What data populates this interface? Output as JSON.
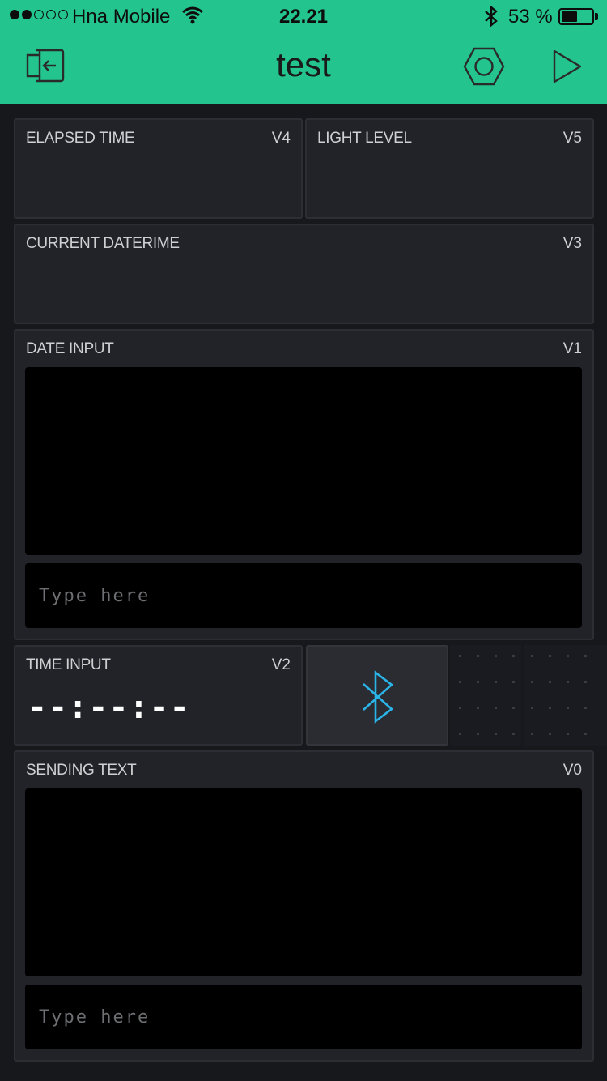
{
  "status_bar": {
    "carrier": "Hna Mobile",
    "time": "22.21",
    "battery_text": "53 %",
    "battery_level": 0.53,
    "signal_bars_filled": 2,
    "signal_bars_total": 5
  },
  "header": {
    "title": "test",
    "background": "#23c48e",
    "icons": [
      "exit-icon",
      "settings-hexagon-icon",
      "play-icon"
    ]
  },
  "widgets": {
    "elapsed_time": {
      "label": "ELAPSED TIME",
      "pin": "V4"
    },
    "light_level": {
      "label": "LIGHT LEVEL",
      "pin": "V5"
    },
    "current_datetime": {
      "label": "CURRENT DATERIME",
      "pin": "V3"
    },
    "date_input": {
      "label": "DATE INPUT",
      "pin": "V1",
      "placeholder": "Type here"
    },
    "time_input": {
      "label": "TIME INPUT",
      "pin": "V2",
      "value": "--:--:--"
    },
    "bluetooth": {
      "icon": "bluetooth-icon",
      "color": "#2bb4e8"
    },
    "sending_text": {
      "label": "SENDING TEXT",
      "pin": "V0",
      "placeholder": "Type here"
    }
  },
  "colors": {
    "app_background": "#17181c",
    "widget_background": "#212328",
    "terminal_background": "#000000",
    "label_text": "#cfd0d2"
  }
}
